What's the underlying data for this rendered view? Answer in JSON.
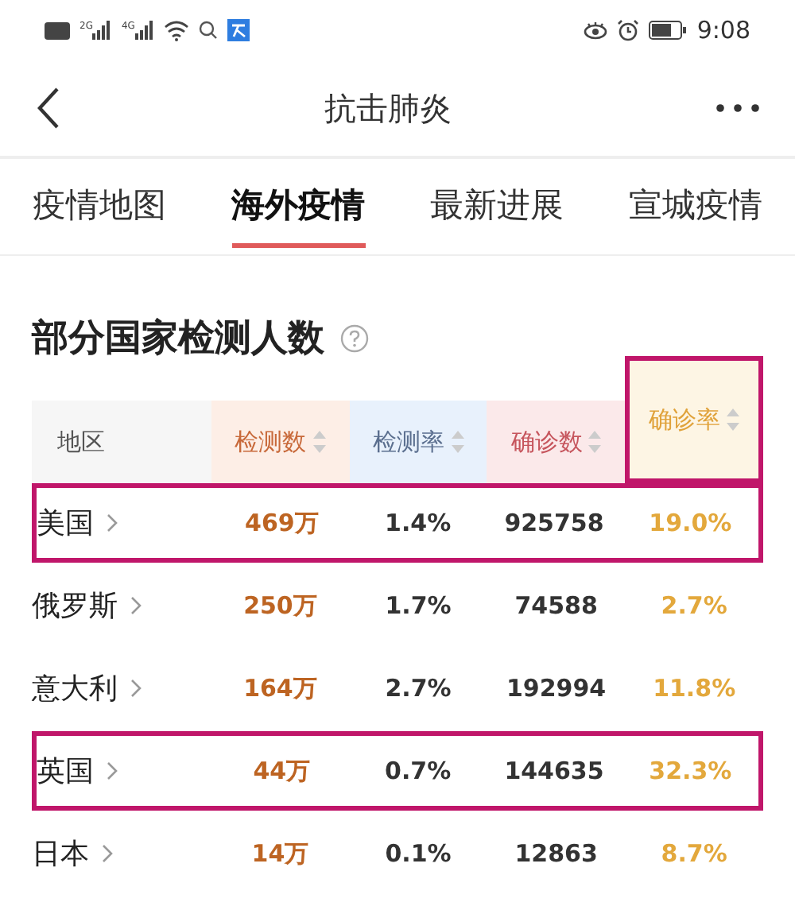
{
  "status_bar": {
    "time": "9:08",
    "signals": [
      "2G",
      "4G"
    ]
  },
  "nav": {
    "title": "抗击肺炎"
  },
  "tabs": [
    {
      "label": "疫情地图",
      "selected": false
    },
    {
      "label": "海外疫情",
      "selected": true
    },
    {
      "label": "最新进展",
      "selected": false
    },
    {
      "label": "宣城疫情",
      "selected": false
    }
  ],
  "section": {
    "title": "部分国家检测人数"
  },
  "table": {
    "columns": [
      {
        "label": "地区",
        "sortable": false,
        "highlighted": false
      },
      {
        "label": "检测数",
        "sortable": true,
        "color": "#fdeee6",
        "highlighted": false
      },
      {
        "label": "检测率",
        "sortable": true,
        "color": "#e8f1fc",
        "highlighted": false
      },
      {
        "label": "确诊数",
        "sortable": true,
        "color": "#fbe9ea",
        "highlighted": false
      },
      {
        "label": "确诊率",
        "sortable": true,
        "color": "#fdf5e4",
        "highlighted": true
      }
    ],
    "rows": [
      {
        "region": "美国",
        "tested": "469万",
        "test_rate": "1.4%",
        "confirmed": "925758",
        "confirm_rate": "19.0%",
        "highlighted": true
      },
      {
        "region": "俄罗斯",
        "tested": "250万",
        "test_rate": "1.7%",
        "confirmed": "74588",
        "confirm_rate": "2.7%",
        "highlighted": false
      },
      {
        "region": "意大利",
        "tested": "164万",
        "test_rate": "2.7%",
        "confirmed": "192994",
        "confirm_rate": "11.8%",
        "highlighted": false
      },
      {
        "region": "英国",
        "tested": "44万",
        "test_rate": "0.7%",
        "confirmed": "144635",
        "confirm_rate": "32.3%",
        "highlighted": true
      },
      {
        "region": "日本",
        "tested": "14万",
        "test_rate": "0.1%",
        "confirmed": "12863",
        "confirm_rate": "8.7%",
        "highlighted": false
      }
    ]
  }
}
